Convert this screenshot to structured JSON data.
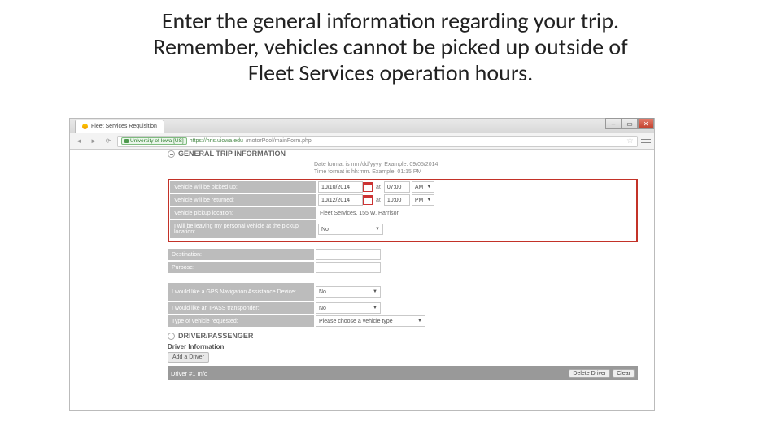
{
  "slide": {
    "title_line1": "Enter the general information regarding your trip.",
    "title_line2": "Remember, vehicles cannot be picked up outside of",
    "title_line3": "Fleet Services operation hours."
  },
  "browser": {
    "tab_title": "Fleet Services Requisition",
    "secure_label": "University of Iowa [US]",
    "url_host": "https://hris.uiowa.edu",
    "url_path": "/motorPool/mainForm.php"
  },
  "form": {
    "section_title": "GENERAL TRIP INFORMATION",
    "hint_line1": "Date format is mm/dd/yyyy. Example: 09/05/2014",
    "hint_line2": "Time format is hh:mm. Example: 01:15 PM",
    "pickup_row": {
      "label": "Vehicle will be picked up:",
      "date": "10/10/2014",
      "at": "at",
      "time": "07:00",
      "ampm": "AM"
    },
    "return_row": {
      "label": "Vehicle will be returned:",
      "date": "10/12/2014",
      "at": "at",
      "time": "10:00",
      "ampm": "PM"
    },
    "location_row": {
      "label": "Vehicle pickup location:",
      "value": "Fleet Services, 155 W. Harrison"
    },
    "leaving_row": {
      "label": "I will be leaving my personal vehicle at the pickup location:",
      "value": "No"
    },
    "destination_label": "Destination:",
    "purpose_label": "Purpose:",
    "gps_row": {
      "label": "I would like a GPS Navigation Assistance Device:",
      "value": "No"
    },
    "ipass_row": {
      "label": "I would like an IPASS transponder:",
      "value": "No"
    },
    "vehicle_row": {
      "label": "Type of vehicle requested:",
      "value": "Please choose a vehicle type"
    },
    "driver_section_title": "DRIVER/PASSENGER",
    "driver_info_label": "Driver Information",
    "add_driver": "Add a Driver",
    "driver_bar_title": "Driver #1 Info",
    "delete_driver": "Delete Driver",
    "clear": "Clear"
  }
}
